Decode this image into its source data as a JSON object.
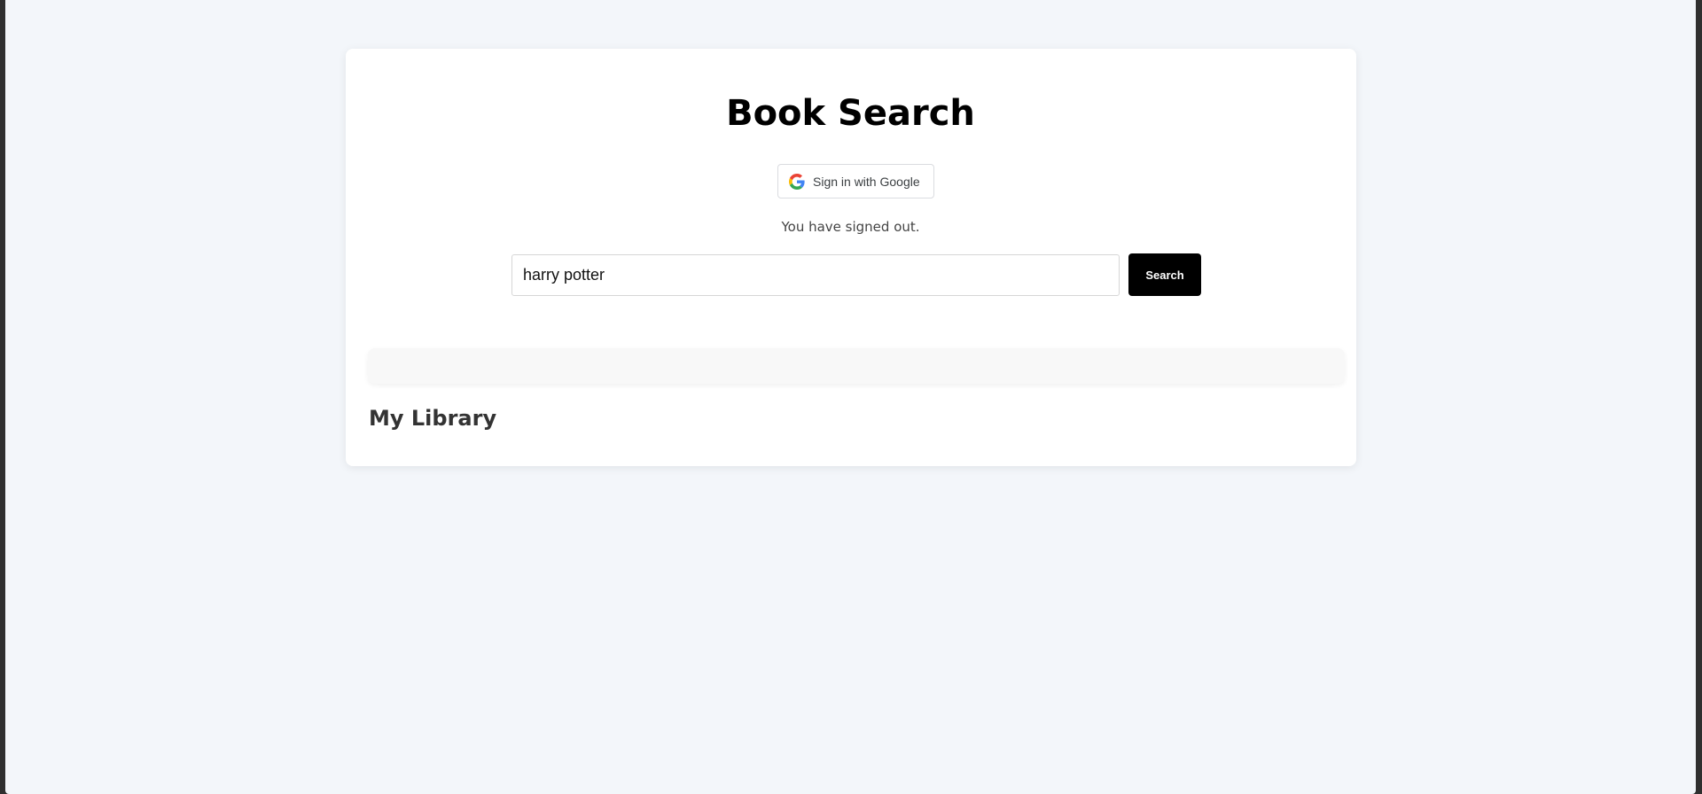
{
  "header": {
    "title": "Book Search"
  },
  "auth": {
    "google_button_label": "Sign in with Google",
    "google_icon": "google-g-icon",
    "status_text": "You have signed out."
  },
  "search": {
    "input_value": "harry potter",
    "button_label": "Search"
  },
  "library": {
    "heading": "My Library"
  },
  "colors": {
    "page_background": "#f3f6fa",
    "card_background": "#ffffff",
    "search_button": "#000000",
    "results_panel": "#f8f8f8"
  }
}
